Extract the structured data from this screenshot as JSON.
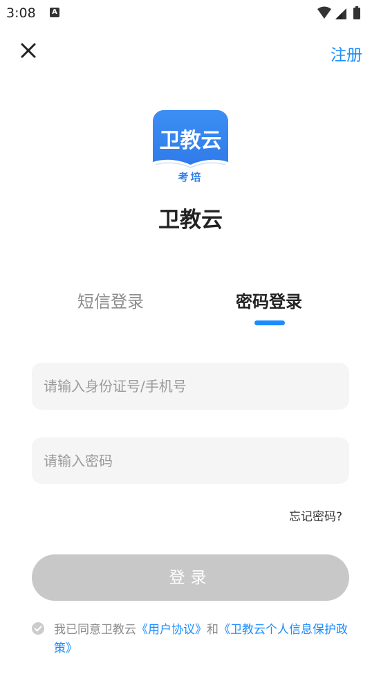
{
  "status_bar": {
    "time": "3:08",
    "notification_letter": "A"
  },
  "header": {
    "register_label": "注册"
  },
  "app": {
    "logo_title": "卫教云",
    "logo_subtitle": "考培",
    "name": "卫教云"
  },
  "tabs": [
    {
      "label": "短信登录",
      "active": false
    },
    {
      "label": "密码登录",
      "active": true
    }
  ],
  "form": {
    "account": {
      "value": "",
      "placeholder": "请输入身份证号/手机号"
    },
    "password": {
      "value": "",
      "placeholder": "请输入密码"
    },
    "forgot_label": "忘记密码?",
    "login_label": "登录"
  },
  "agreement": {
    "prefix": "我已同意卫教云",
    "user_agreement": "《用户协议》",
    "conjunction": "和",
    "privacy_policy": "《卫教云个人信息保护政策》"
  },
  "colors": {
    "accent": "#1a8cff",
    "logo_blue": "#2f80f0",
    "input_bg": "#f5f5f5",
    "disabled_button": "#c8c8c8"
  }
}
